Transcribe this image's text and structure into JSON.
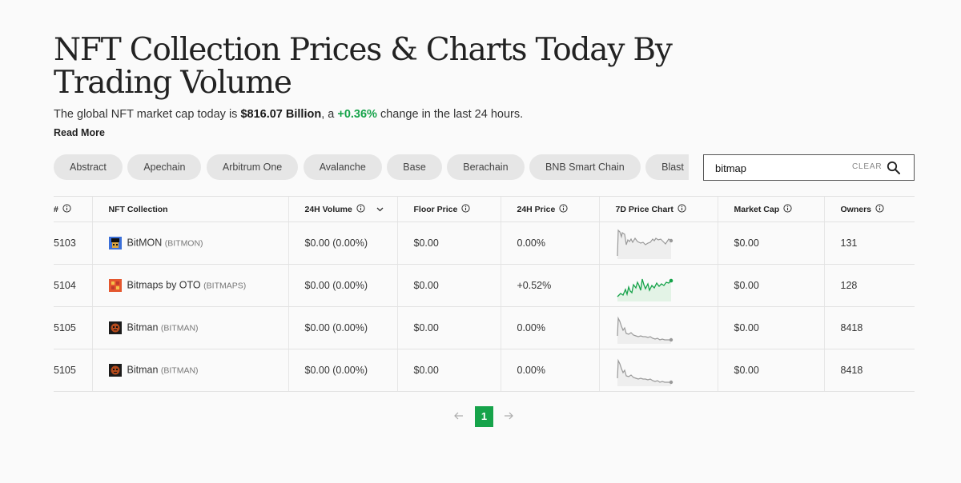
{
  "page": {
    "title": "NFT Collection Prices & Charts Today By Trading Volume",
    "summary_prefix": "The global NFT market cap today is ",
    "market_cap": "$816.07 Billion",
    "summary_mid": ", a ",
    "change": "+0.36%",
    "summary_suffix": " change in the last 24 hours.",
    "read_more": "Read More"
  },
  "chains": [
    "Abstract",
    "Apechain",
    "Arbitrum One",
    "Avalanche",
    "Base",
    "Berachain",
    "BNB Smart Chain",
    "Blast"
  ],
  "search": {
    "value": "bitmap",
    "clear_label": "CLEAR"
  },
  "table": {
    "headers": {
      "rank": "#",
      "collection": "NFT Collection",
      "volume": "24H Volume",
      "floor": "Floor Price",
      "price_change": "24H Price",
      "chart": "7D Price Chart",
      "market_cap": "Market Cap",
      "owners": "Owners"
    },
    "rows": [
      {
        "rank": "5103",
        "name": "BitMON",
        "symbol": "(BITMON)",
        "volume": "$0.00 (0.00%)",
        "floor": "$0.00",
        "change": "0.00%",
        "trend": "flat",
        "market_cap": "$0.00",
        "owners": "131",
        "icon": "bitmon-avatar-icon"
      },
      {
        "rank": "5104",
        "name": "Bitmaps by OTO",
        "symbol": "(BITMAPS)",
        "volume": "$0.00 (0.00%)",
        "floor": "$0.00",
        "change": "+0.52%",
        "trend": "up",
        "market_cap": "$0.00",
        "owners": "128",
        "icon": "bitmaps-avatar-icon"
      },
      {
        "rank": "5105",
        "name": "Bitman",
        "symbol": "(BITMAN)",
        "volume": "$0.00 (0.00%)",
        "floor": "$0.00",
        "change": "0.00%",
        "trend": "flat",
        "market_cap": "$0.00",
        "owners": "8418",
        "icon": "bitman-avatar-icon"
      },
      {
        "rank": "5105",
        "name": "Bitman",
        "symbol": "(BITMAN)",
        "volume": "$0.00 (0.00%)",
        "floor": "$0.00",
        "change": "0.00%",
        "trend": "flat",
        "market_cap": "$0.00",
        "owners": "8418",
        "icon": "bitman-avatar-icon"
      }
    ]
  },
  "pagination": {
    "current": "1"
  },
  "colors": {
    "positive": "#16a34a",
    "flat_line": "#9a9a9a",
    "chip_bg": "#e6e6e6"
  }
}
